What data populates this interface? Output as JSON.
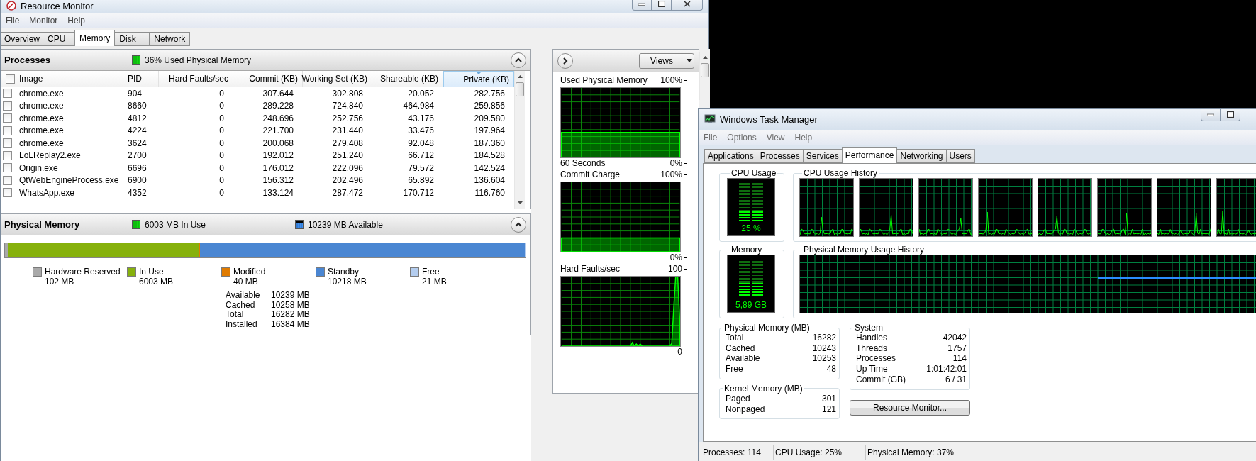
{
  "resource_monitor": {
    "title": "Resource Monitor",
    "menu": [
      "File",
      "Monitor",
      "Help"
    ],
    "tabs": [
      {
        "label": "Overview",
        "selected": false
      },
      {
        "label": "CPU",
        "selected": false
      },
      {
        "label": "Memory",
        "selected": true
      },
      {
        "label": "Disk",
        "selected": false
      },
      {
        "label": "Network",
        "selected": false
      }
    ],
    "processes": {
      "title": "Processes",
      "summary": "36% Used Physical Memory",
      "columns": [
        {
          "label": "Image",
          "sorted": false
        },
        {
          "label": "PID",
          "sorted": false
        },
        {
          "label": "Hard Faults/sec",
          "sorted": false
        },
        {
          "label": "Commit (KB)",
          "sorted": false
        },
        {
          "label": "Working Set (KB)",
          "sorted": false
        },
        {
          "label": "Shareable (KB)",
          "sorted": false
        },
        {
          "label": "Private (KB)",
          "sorted": true
        }
      ],
      "rows": [
        {
          "checked": false,
          "cells": [
            "chrome.exe",
            "904",
            "0",
            "307.644",
            "302.808",
            "20.052",
            "282.756"
          ]
        },
        {
          "checked": false,
          "cells": [
            "chrome.exe",
            "8660",
            "0",
            "289.228",
            "724.840",
            "464.984",
            "259.856"
          ]
        },
        {
          "checked": false,
          "cells": [
            "chrome.exe",
            "4812",
            "0",
            "248.696",
            "252.756",
            "43.176",
            "209.580"
          ]
        },
        {
          "checked": false,
          "cells": [
            "chrome.exe",
            "4224",
            "0",
            "221.700",
            "231.440",
            "33.476",
            "197.964"
          ]
        },
        {
          "checked": false,
          "cells": [
            "chrome.exe",
            "3624",
            "0",
            "200.068",
            "279.408",
            "92.048",
            "187.360"
          ]
        },
        {
          "checked": false,
          "cells": [
            "LoLReplay2.exe",
            "2700",
            "0",
            "192.012",
            "251.240",
            "66.712",
            "184.528"
          ]
        },
        {
          "checked": false,
          "cells": [
            "Origin.exe",
            "6696",
            "0",
            "176.012",
            "222.096",
            "79.572",
            "142.524"
          ]
        },
        {
          "checked": false,
          "cells": [
            "QtWebEngineProcess.exe",
            "6900",
            "0",
            "156.312",
            "202.496",
            "65.892",
            "136.604"
          ]
        },
        {
          "checked": false,
          "cells": [
            "WhatsApp.exe",
            "4352",
            "0",
            "133.124",
            "287.472",
            "170.712",
            "116.760"
          ]
        }
      ]
    },
    "physical_memory": {
      "title": "Physical Memory",
      "in_use": "6003 MB In Use",
      "available": "10239 MB Available",
      "segments": [
        {
          "label": "Hardware Reserved",
          "value": "102 MB",
          "color": "#a9a9a9",
          "level": 0.006
        },
        {
          "label": "In Use",
          "value": "6003 MB",
          "color": "#86b10c",
          "level": 0.366
        },
        {
          "label": "Modified",
          "value": "40 MB",
          "color": "#e07b00",
          "level": 0.003
        },
        {
          "label": "Standby",
          "value": "10218 MB",
          "color": "#4a86d2",
          "level": 0.624
        },
        {
          "label": "Free",
          "value": "21 MB",
          "color": "#b4cdef",
          "level": 0.001
        }
      ],
      "stats": [
        {
          "label": "Available",
          "value": "10239 MB"
        },
        {
          "label": "Cached",
          "value": "10258 MB"
        },
        {
          "label": "Total",
          "value": "16282 MB"
        },
        {
          "label": "Installed",
          "value": "16384 MB"
        }
      ]
    },
    "graphs_pane": {
      "views_button": "Views",
      "graphs": [
        {
          "title": "Used Physical Memory",
          "max": "100%",
          "time_span": "60 Seconds",
          "min": "0%"
        },
        {
          "title": "Commit Charge",
          "max": "100%",
          "min": "0%"
        },
        {
          "title": "Hard Faults/sec",
          "max": "100",
          "min": "0"
        }
      ]
    }
  },
  "task_manager": {
    "title": "Windows Task Manager",
    "menu": [
      "File",
      "Options",
      "View",
      "Help"
    ],
    "tabs": [
      {
        "label": "Applications",
        "selected": false
      },
      {
        "label": "Processes",
        "selected": false
      },
      {
        "label": "Services",
        "selected": false
      },
      {
        "label": "Performance",
        "selected": true
      },
      {
        "label": "Networking",
        "selected": false
      },
      {
        "label": "Users",
        "selected": false
      }
    ],
    "cpu_usage": {
      "title": "CPU Usage",
      "reading": "25 %",
      "level": 0.25
    },
    "cpu_history": {
      "title": "CPU Usage History"
    },
    "memory": {
      "title": "Memory",
      "reading": "5,89 GB",
      "level": 0.37
    },
    "memory_history": {
      "title": "Physical Memory Usage History"
    },
    "physical_memory": {
      "title": "Physical Memory (MB)",
      "rows": [
        {
          "label": "Total",
          "value": "16282"
        },
        {
          "label": "Cached",
          "value": "10243"
        },
        {
          "label": "Available",
          "value": "10253"
        },
        {
          "label": "Free",
          "value": "48"
        }
      ]
    },
    "kernel_memory": {
      "title": "Kernel Memory (MB)",
      "rows": [
        {
          "label": "Paged",
          "value": "301"
        },
        {
          "label": "Nonpaged",
          "value": "121"
        }
      ]
    },
    "system": {
      "title": "System",
      "rows": [
        {
          "label": "Handles",
          "value": "42042"
        },
        {
          "label": "Threads",
          "value": "1757"
        },
        {
          "label": "Processes",
          "value": "114"
        },
        {
          "label": "Up Time",
          "value": "1:01:42:01"
        },
        {
          "label": "Commit (GB)",
          "value": "6 / 31"
        }
      ]
    },
    "resource_monitor_button": "Resource Monitor...",
    "status_bar": [
      "Processes: 114",
      "CPU Usage: 25%",
      "Physical Memory: 37%"
    ]
  }
}
